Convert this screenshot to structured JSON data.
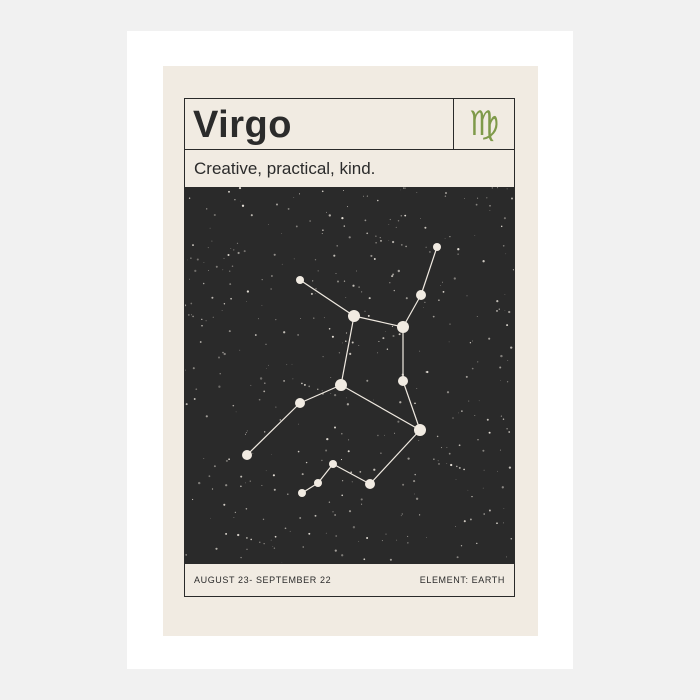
{
  "poster": {
    "title": "Virgo",
    "symbol": "♍",
    "symbol_icon": "virgo-zodiac-glyph",
    "tagline": "Creative, practical, kind.",
    "dates": "AUGUST 23- SEPTEMBER 22",
    "element": "ELEMENT: EARTH"
  },
  "colors": {
    "background": "#f1ebe2",
    "sky": "#2a2a2a",
    "ink": "#2b2b2b",
    "accent": "#7f9a4a",
    "star": "#f1ebe2"
  }
}
